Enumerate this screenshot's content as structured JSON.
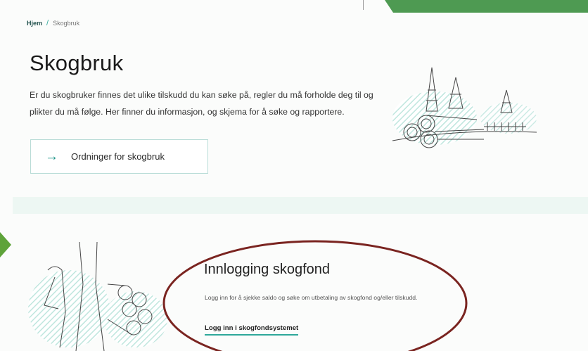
{
  "breadcrumb": {
    "home": "Hjem",
    "separator": "/",
    "current": "Skogbruk"
  },
  "page": {
    "title": "Skogbruk",
    "intro": "Er du skogbruker finnes det ulike tilskudd du kan søke på, regler du må forholde deg til og plikter du må følge. Her finner du informasjon, og skjema for å søke og rapportere."
  },
  "schemes_button": {
    "icon": "arrow-right-icon",
    "label": "Ordninger for skogbruk"
  },
  "login_section": {
    "title": "Innlogging skogfond",
    "description": "Logg inn for å sjekke saldo og søke om utbetaling av skogfond og/eller tilskudd.",
    "link_label": "Logg inn i skogfondsystemet"
  },
  "colors": {
    "accent": "#2ea89a",
    "brand_green": "#4e9a52",
    "annotation_ring": "#7a2420",
    "band": "#edf7f3"
  }
}
